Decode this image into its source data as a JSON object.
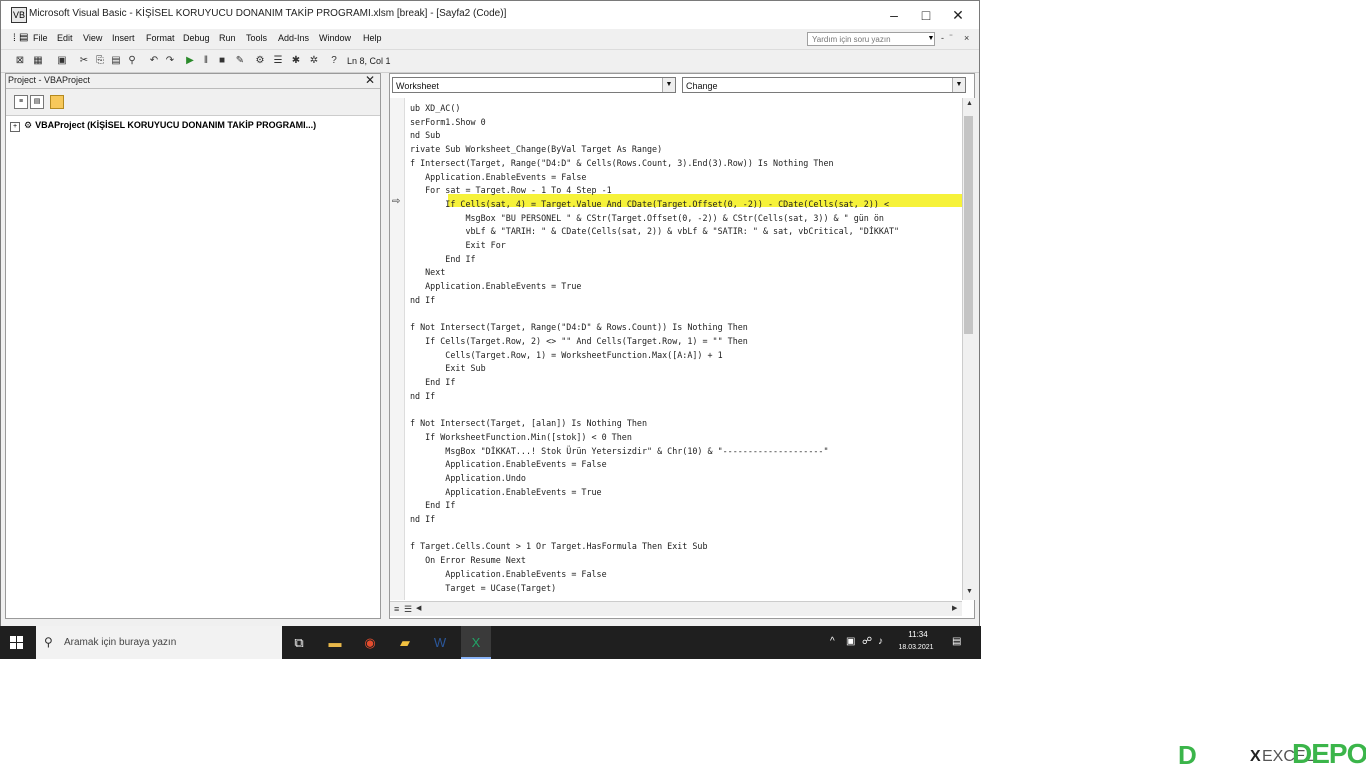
{
  "window": {
    "title": "Microsoft Visual Basic - KİŞİSEL KORUYUCU DONANIM TAKİP PROGRAMI.xlsm [break] - [Sayfa2 (Code)]",
    "minimize": "–",
    "maximize": "□",
    "close": "✕"
  },
  "menubar": {
    "items": [
      "File",
      "Edit",
      "View",
      "Insert",
      "Format",
      "Debug",
      "Run",
      "Tools",
      "Add-Ins",
      "Window",
      "Help"
    ],
    "help_placeholder": "Yardım için soru yazın",
    "mdi_min": "-",
    "mdi_restore": "̈",
    "mdi_close": "×"
  },
  "toolbar": {
    "position": "Ln 8, Col 1"
  },
  "project_pane": {
    "title": "Project - VBAProject",
    "close": "✕",
    "tree_root": "VBAProject (KİŞİSEL KORUYUCU DONANIM TAKİP PROGRAMI...)"
  },
  "code_window": {
    "object_combo": "Worksheet",
    "procedure_combo": "Change",
    "lines": [
      "ub XD_AC()",
      "serForm1.Show 0",
      "nd Sub",
      "rivate Sub Worksheet_Change(ByVal Target As Range)",
      "f Intersect(Target, Range(\"D4:D\" & Cells(Rows.Count, 3).End(3).Row)) Is Nothing Then",
      "   Application.EnableEvents = False",
      "   For sat = Target.Row - 1 To 4 Step -1",
      "       If Cells(sat, 4) = Target.Value And CDate(Target.Offset(0, -2)) - CDate(Cells(sat, 2)) <",
      "           MsgBox \"BU PERSONEL \" & CStr(Target.Offset(0, -2)) & CStr(Cells(sat, 3)) & \" gün ön",
      "           vbLf & \"TARIH: \" & CDate(Cells(sat, 2)) & vbLf & \"SATIR: \" & sat, vbCritical, \"DİKKAT\"",
      "           Exit For",
      "       End If",
      "   Next",
      "   Application.EnableEvents = True",
      "nd If",
      "",
      "f Not Intersect(Target, Range(\"D4:D\" & Rows.Count)) Is Nothing Then",
      "   If Cells(Target.Row, 2) <> \"\" And Cells(Target.Row, 1) = \"\" Then",
      "       Cells(Target.Row, 1) = WorksheetFunction.Max([A:A]) + 1",
      "       Exit Sub",
      "   End If",
      "nd If",
      "",
      "f Not Intersect(Target, [alan]) Is Nothing Then",
      "   If WorksheetFunction.Min([stok]) < 0 Then",
      "       MsgBox \"DİKKAT...! Stok Ürün Yetersizdir\" & Chr(10) & \"--------------------\"",
      "       Application.EnableEvents = False",
      "       Application.Undo",
      "       Application.EnableEvents = True",
      "   End If",
      "nd If",
      "",
      "f Target.Cells.Count > 1 Or Target.HasFormula Then Exit Sub",
      "   On Error Resume Next",
      "       Application.EnableEvents = False",
      "       Target = UCase(Target)"
    ]
  },
  "taskbar": {
    "search_placeholder": "Aramak için buraya yazın",
    "time": "11:34",
    "date": "18.03.2021"
  },
  "watermark": {
    "text": "EXCEL",
    "x": "X",
    "depo": "DEPO",
    "d": "D"
  },
  "colors": {
    "highlight": "#f6f23a",
    "taskbar": "#1f1f1f",
    "brand_green": "#3bb54a"
  }
}
